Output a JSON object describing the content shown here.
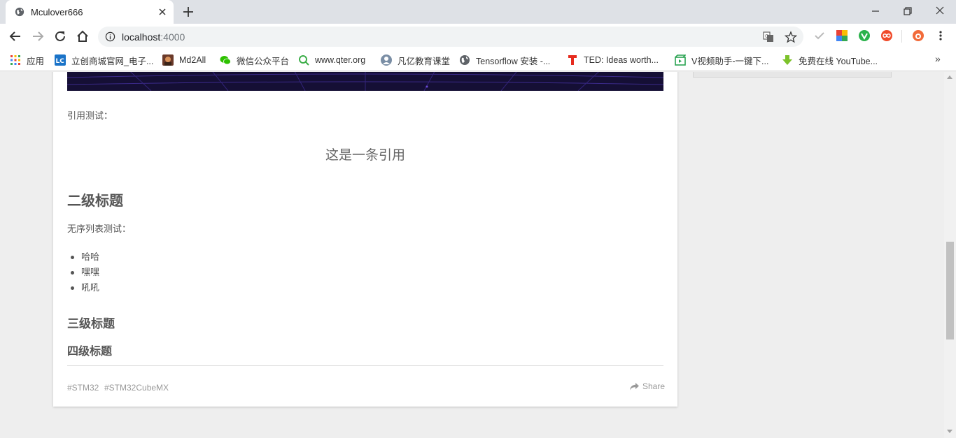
{
  "browser": {
    "tab": {
      "title": "Mculover666"
    },
    "omnibox": {
      "host": "localhost",
      "port": ":4000"
    }
  },
  "bookmarks": [
    {
      "label": "应用",
      "icon": "apps-grid-icon"
    },
    {
      "label": "立创商城官网_电子...",
      "icon": "lc-logo-icon"
    },
    {
      "label": "Md2All",
      "icon": "md2all-icon"
    },
    {
      "label": "微信公众平台",
      "icon": "wechat-icon"
    },
    {
      "label": "www.qter.org",
      "icon": "qter-icon"
    },
    {
      "label": "凡亿教育课堂",
      "icon": "user-icon"
    },
    {
      "label": "Tensorflow 安装 -...",
      "icon": "globe-icon"
    },
    {
      "label": "TED: Ideas worth...",
      "icon": "ted-icon"
    },
    {
      "label": "V视频助手-一键下...",
      "icon": "video-icon"
    },
    {
      "label": "免费在线 YouTube...",
      "icon": "download-icon"
    }
  ],
  "article": {
    "quote_label": "引用测试：",
    "quote": "这是一条引用",
    "h2": "二级标题",
    "list_label": "无序列表测试：",
    "list_items": [
      "哈哈",
      "嘿嘿",
      "吼吼"
    ],
    "h3": "三级标题",
    "h4": "四级标题",
    "tags": [
      "#STM32",
      "#STM32CubeMX"
    ],
    "share_label": "Share"
  },
  "colors": {
    "banner": "#150f35",
    "text": "#555555",
    "page_background": "#eeeeee"
  }
}
